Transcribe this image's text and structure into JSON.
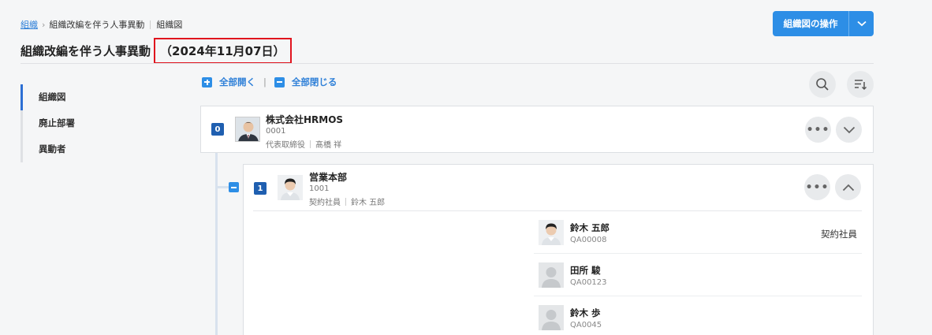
{
  "breadcrumb": {
    "root": "組織",
    "current": "組織改編を伴う人事異動",
    "page": "組織図"
  },
  "title": {
    "main": "組織改編を伴う人事異動",
    "date": "（2024年11月07日）"
  },
  "actions": {
    "operation_label": "組織図の操作"
  },
  "sidebar": {
    "items": [
      {
        "label": "組織図",
        "active": true
      },
      {
        "label": "廃止部署",
        "active": false
      },
      {
        "label": "異動者",
        "active": false
      }
    ]
  },
  "toolbar": {
    "expand_all": "全部開く",
    "separator": "|",
    "collapse_all": "全部閉じる"
  },
  "org_root": {
    "level": "0",
    "name": "株式会社HRMOS",
    "code": "0001",
    "leader_title": "代表取締役",
    "leader_name": "髙橋 祥"
  },
  "org_child": {
    "level": "1",
    "name": "営業本部",
    "code": "1001",
    "leader_title": "契約社員",
    "leader_name": "鈴木 五郎"
  },
  "members": [
    {
      "name": "鈴木 五郎",
      "code": "QA00008",
      "employment_type": "契約社員",
      "photo": "male-young"
    },
    {
      "name": "田所 駿",
      "code": "QA00123",
      "employment_type": "",
      "photo": "placeholder"
    },
    {
      "name": "鈴木 歩",
      "code": "QA0045",
      "employment_type": "",
      "photo": "placeholder"
    }
  ],
  "colors": {
    "primary": "#2d8ee6",
    "link": "#2f80d8",
    "badge": "#1f5fb0",
    "highlight": "#e0141e"
  }
}
